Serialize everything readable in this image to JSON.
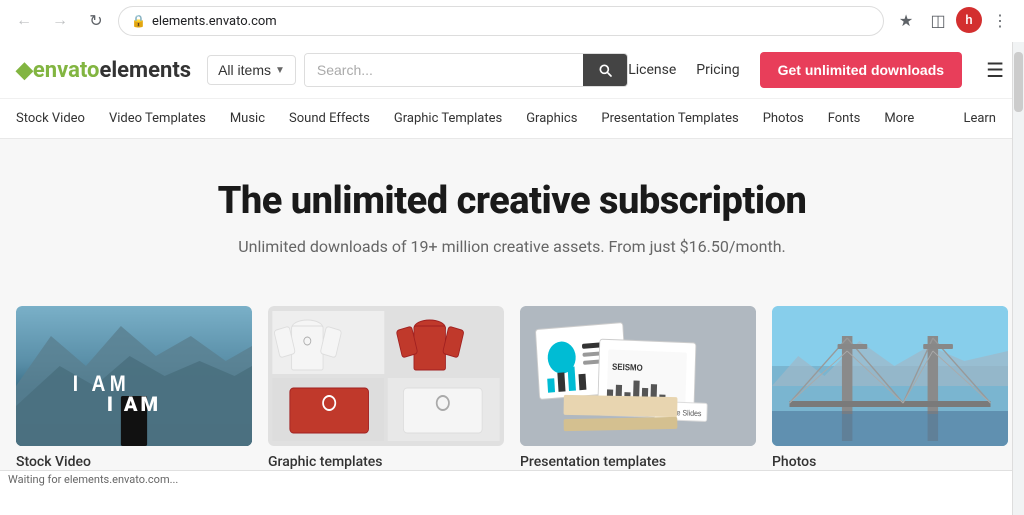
{
  "browser": {
    "url": "elements.envato.com",
    "status_text": "Waiting for elements.envato.com...",
    "avatar_letter": "h"
  },
  "header": {
    "logo_envato": "envato",
    "logo_elements": "elements",
    "all_items_label": "All items",
    "search_placeholder": "Search...",
    "license_label": "License",
    "pricing_label": "Pricing",
    "cta_label": "Get unlimited downloads"
  },
  "categories": [
    {
      "id": "stock-video",
      "label": "Stock Video"
    },
    {
      "id": "video-templates",
      "label": "Video Templates"
    },
    {
      "id": "music",
      "label": "Music"
    },
    {
      "id": "sound-effects",
      "label": "Sound Effects"
    },
    {
      "id": "graphic-templates",
      "label": "Graphic Templates"
    },
    {
      "id": "graphics",
      "label": "Graphics"
    },
    {
      "id": "presentation-templates",
      "label": "Presentation Templates"
    },
    {
      "id": "photos",
      "label": "Photos"
    },
    {
      "id": "fonts",
      "label": "Fonts"
    },
    {
      "id": "more",
      "label": "More"
    },
    {
      "id": "learn",
      "label": "Learn"
    }
  ],
  "hero": {
    "title": "The unlimited creative subscription",
    "subtitle": "Unlimited downloads of 19+ million creative assets. From just $16.50/month."
  },
  "cards": [
    {
      "id": "stock-video-card",
      "type": "stock-video",
      "label": "Stock Video"
    },
    {
      "id": "graphic-templates-card",
      "type": "graphic-templates",
      "label": "Graphic templates"
    },
    {
      "id": "presentation-templates-card",
      "type": "presentation-templates",
      "label": "Presentation templates"
    },
    {
      "id": "photos-card",
      "type": "photos",
      "label": "Photos"
    }
  ]
}
